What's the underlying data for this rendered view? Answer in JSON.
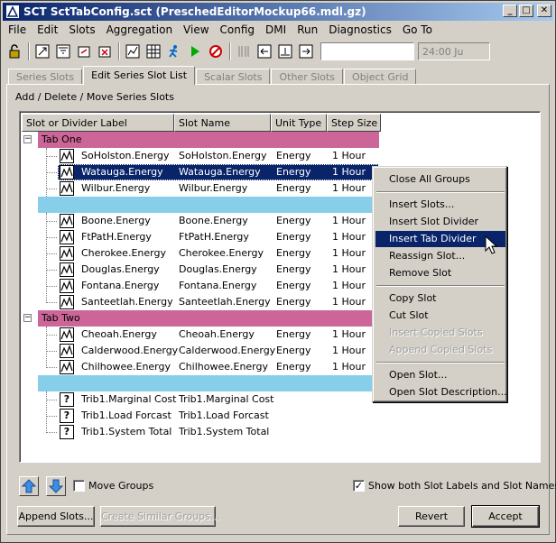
{
  "window": {
    "title": "SCT SctTabConfig.sct (PreschedEditorMockup66.mdl.gz)",
    "controls": [
      "_",
      "□",
      "✕"
    ]
  },
  "menu": [
    "File",
    "Edit",
    "Slots",
    "Aggregation",
    "View",
    "Config",
    "DMI",
    "Run",
    "Diagnostics",
    "Go To"
  ],
  "toolbar": {
    "time_value": "24:00 Ju"
  },
  "tabs": [
    "Series Slots",
    "Edit Series Slot List",
    "Scalar Slots",
    "Other Slots",
    "Object Grid"
  ],
  "section_label": "Add / Delete / Move Series Slots",
  "columns": [
    "Slot or Divider Label",
    "Slot Name",
    "Unit Type",
    "Step Size"
  ],
  "rows": [
    {
      "kind": "group",
      "color": "#cc6699",
      "label": "Tab One"
    },
    {
      "kind": "slot",
      "label": "SoHolston.Energy",
      "name": "SoHolston.Energy",
      "unit": "Energy",
      "step": "1 Hour"
    },
    {
      "kind": "slot",
      "label": "Watauga.Energy",
      "name": "Watauga.Energy",
      "unit": "Energy",
      "step": "1 Hour",
      "selected": true
    },
    {
      "kind": "slot",
      "label": "Wilbur.Energy",
      "name": "Wilbur.Energy",
      "unit": "Energy",
      "step": "1 Hour"
    },
    {
      "kind": "divider",
      "color": "#87ceeb",
      "label": ""
    },
    {
      "kind": "slot",
      "label": "Boone.Energy",
      "name": "Boone.Energy",
      "unit": "Energy",
      "step": "1 Hour"
    },
    {
      "kind": "slot",
      "label": "FtPatH.Energy",
      "name": "FtPatH.Energy",
      "unit": "Energy",
      "step": "1 Hour"
    },
    {
      "kind": "slot",
      "label": "Cherokee.Energy",
      "name": "Cherokee.Energy",
      "unit": "Energy",
      "step": "1 Hour"
    },
    {
      "kind": "slot",
      "label": "Douglas.Energy",
      "name": "Douglas.Energy",
      "unit": "Energy",
      "step": "1 Hour"
    },
    {
      "kind": "slot",
      "label": "Fontana.Energy",
      "name": "Fontana.Energy",
      "unit": "Energy",
      "step": "1 Hour"
    },
    {
      "kind": "slot",
      "label": "Santeetlah.Energy",
      "name": "Santeetlah.Energy",
      "unit": "Energy",
      "step": "1 Hour"
    },
    {
      "kind": "group",
      "color": "#cc6699",
      "label": "Tab Two"
    },
    {
      "kind": "slot",
      "label": "Cheoah.Energy",
      "name": "Cheoah.Energy",
      "unit": "Energy",
      "step": "1 Hour"
    },
    {
      "kind": "slot",
      "label": "Calderwood.Energy",
      "name": "Calderwood.Energy",
      "unit": "Energy",
      "step": "1 Hour"
    },
    {
      "kind": "slot",
      "label": "Chilhowee.Energy",
      "name": "Chilhowee.Energy",
      "unit": "Energy",
      "step": "1 Hour"
    },
    {
      "kind": "divider",
      "color": "#87ceeb",
      "label": ""
    },
    {
      "kind": "scalar",
      "label": "Trib1.Marginal Cost",
      "name": "Trib1.Marginal Cost",
      "unit": "",
      "step": ""
    },
    {
      "kind": "scalar",
      "label": "Trib1.Load Forcast",
      "name": "Trib1.Load Forcast",
      "unit": "",
      "step": ""
    },
    {
      "kind": "scalar",
      "label": "Trib1.System Total",
      "name": "Trib1.System Total",
      "unit": "",
      "step": ""
    }
  ],
  "context_menu": {
    "close_all_groups": "Close All Groups",
    "insert_slots": "Insert Slots...",
    "insert_slot_divider": "Insert Slot Divider",
    "insert_tab_divider": "Insert Tab Divider",
    "reassign_slot": "Reassign Slot...",
    "remove_slot": "Remove Slot",
    "copy_slot": "Copy Slot",
    "cut_slot": "Cut Slot",
    "insert_copied_slots": "Insert Copied Slots",
    "append_copied_slots": "Append Copied Slots",
    "open_slot": "Open Slot...",
    "open_slot_description": "Open Slot Description..."
  },
  "bottom": {
    "move_groups_label": "Move Groups",
    "move_groups_checked": false,
    "show_both_label": "Show both Slot Labels and Slot Names",
    "show_both_checked": true,
    "append_slots": "Append Slots...",
    "create_similar_groups": "Create Similar Groups...",
    "revert": "Revert",
    "accept": "Accept"
  }
}
